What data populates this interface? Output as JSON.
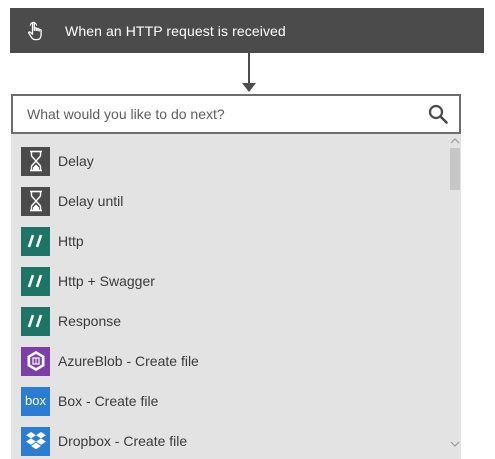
{
  "trigger": {
    "title": "When an HTTP request is received",
    "icon": "hand-pointer-icon"
  },
  "search": {
    "placeholder": "What would you like to do next?",
    "icon": "search-icon"
  },
  "actions": [
    {
      "label": "Delay",
      "icon": "hourglass-icon",
      "icon_bg": "#4b4b4b"
    },
    {
      "label": "Delay until",
      "icon": "hourglass-icon",
      "icon_bg": "#4b4b4b"
    },
    {
      "label": "Http",
      "icon": "http-slashes-icon",
      "icon_bg": "#1e7565"
    },
    {
      "label": "Http + Swagger",
      "icon": "http-slashes-icon",
      "icon_bg": "#1e7565"
    },
    {
      "label": "Response",
      "icon": "http-slashes-icon",
      "icon_bg": "#1e7565"
    },
    {
      "label": "AzureBlob - Create file",
      "icon": "azure-blob-icon",
      "icon_bg": "#7d3ea8"
    },
    {
      "label": "Box - Create file",
      "icon": "box-logo-icon",
      "icon_bg": "#2b7cd3",
      "icon_text": "box"
    },
    {
      "label": "Dropbox - Create file",
      "icon": "dropbox-logo-icon",
      "icon_bg": "#2b7cd3"
    }
  ],
  "colors": {
    "trigger_bar": "#4b4b4b",
    "panel_bg": "#e3e3e3",
    "search_border": "#6d6d6d"
  }
}
